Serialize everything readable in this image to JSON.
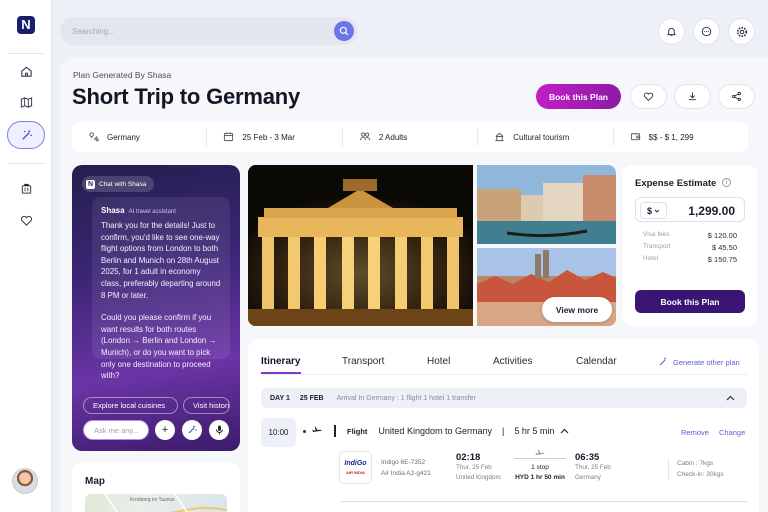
{
  "sidebar": {
    "logo_letter": "N",
    "items": [
      {
        "name": "home-icon"
      },
      {
        "name": "map-icon"
      },
      {
        "name": "magic-wand-icon",
        "active": true
      },
      {
        "name": "luggage-icon"
      },
      {
        "name": "heart-icon"
      }
    ]
  },
  "search": {
    "placeholder": "Searching..."
  },
  "header": {
    "kicker": "Plan Generated By Shasa",
    "title": "Short Trip to Germany",
    "book_label": "Book this Plan"
  },
  "facts": [
    {
      "icon": "destination-icon",
      "label": "Germany"
    },
    {
      "icon": "calendar-icon",
      "label": "25 Feb - 3 Mar"
    },
    {
      "icon": "people-icon",
      "label": "2 Adults"
    },
    {
      "icon": "tourism-icon",
      "label": "Cultural tourism"
    },
    {
      "icon": "wallet-icon",
      "label": "$$ - $ 1, 299"
    }
  ],
  "chat": {
    "tag": "Chat with Shasa",
    "sender": "Shasa",
    "sender_role": "AI travel assistant",
    "message_1": "Thank you for the details! Just to confirm, you'd like to see one-way flight options from London to both Berlin and Munich on 28th August 2025, for 1 adult in economy class, preferably departing around 8 PM or later.",
    "message_2": "Could you please confirm if you want results for both routes (London → Berlin and London → Munich), or do you want to pick only one destination to proceed with?",
    "chips": [
      "Explore local cuisines",
      "Visit historical sites"
    ],
    "input_placeholder": "Ask me any..."
  },
  "map": {
    "title": "Map",
    "city_label": "Kronberg im Taunus"
  },
  "gallery": {
    "view_more": "View more"
  },
  "expense": {
    "title": "Expense Estimate",
    "currency": "$",
    "total": "1,299.00",
    "rows": [
      {
        "label": "Visa fees",
        "value": "$ 120.00"
      },
      {
        "label": "Transport",
        "value": "$ 45.50"
      },
      {
        "label": "Hotel",
        "value": "$ 150.75"
      }
    ],
    "book_label": "Book this Plan"
  },
  "itinerary": {
    "tabs": [
      "Itinerary",
      "Transport",
      "Hotel",
      "Activities",
      "Calendar"
    ],
    "generate_label": "Generate other plan",
    "day": {
      "label": "DAY 1",
      "date": "25 FEB",
      "summary": "Arrival In Germany : 1 flight 1 hotel 1 transfer"
    },
    "flight": {
      "time": "10:00",
      "type": "Flight",
      "route": "United Kingdom to Germany",
      "separator": "|",
      "duration": "5 hr 5 min",
      "remove_label": "Remove",
      "change_label": "Change",
      "airline_logo": "IndiGo",
      "airline_logo_sub": "AIR INDIA",
      "codes": [
        "Indigo 6E-7352",
        "Air India A2-g421"
      ],
      "depart": {
        "time": "02:18",
        "date": "Thur, 25 Feb",
        "place": "United Kingdom"
      },
      "arrive": {
        "time": "06:35",
        "date": "Thur, 25 Feb",
        "place": "Germany"
      },
      "stops": "1 stop",
      "layover": "HYD 1 hr 50 min",
      "baggage": [
        "Cabin : 7kgs",
        "Check-in: 30kgs"
      ]
    }
  },
  "colors": {
    "accent": "#7a39c9",
    "brand": "#1a1f6b",
    "book_gradient_start": "#c21ec4",
    "expense_button": "#3b1574"
  }
}
